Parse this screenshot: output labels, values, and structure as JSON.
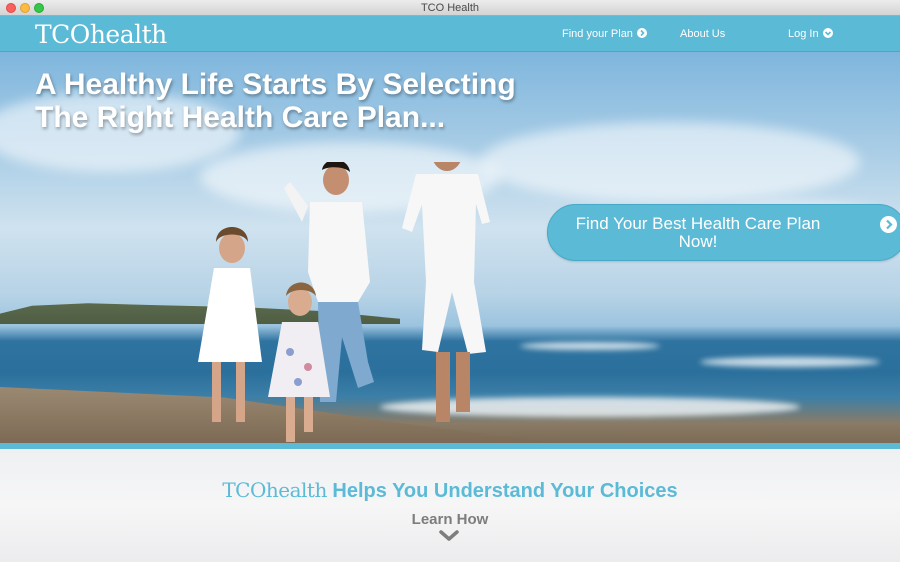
{
  "window": {
    "title": "TCO Health"
  },
  "nav": {
    "logo": "TCOhealth",
    "logo_prefix": "TCO",
    "logo_suffix": "health",
    "links": [
      {
        "label": "Find your Plan",
        "icon": "circle-chevron-right-icon"
      },
      {
        "label": "About Us",
        "icon": ""
      },
      {
        "label": "Log In",
        "icon": "circle-chevron-down-icon"
      }
    ]
  },
  "hero": {
    "headline_line1": "A Healthy Life Starts By Selecting",
    "headline_line2": "The Right Health Care Plan...",
    "cta_line1": "Find Your Best Health Care Plan",
    "cta_line2": "Now!",
    "cta_icon": "circle-chevron-right-icon"
  },
  "info": {
    "brand_prefix": "TCO",
    "brand_suffix": "health",
    "tagline": "Helps You Understand Your Choices",
    "learn_label": "Learn How",
    "learn_icon": "chevron-down-icon"
  },
  "colors": {
    "accent": "#5bbad6",
    "window_chrome": "#d3d3d3",
    "learn_text": "#7d7d7d"
  }
}
